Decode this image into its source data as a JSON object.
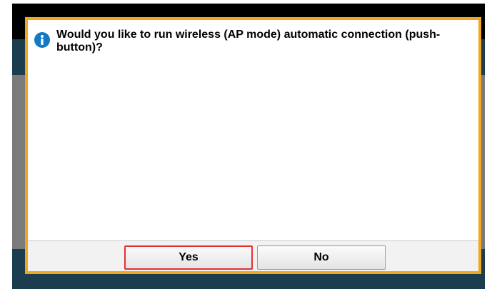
{
  "dialog": {
    "message": "Would you like to run wireless (AP mode) automatic connection (push-button)?",
    "icon": "info-icon",
    "accent_color": "#f0a81e",
    "icon_color": "#1279c6"
  },
  "buttons": {
    "yes_label": "Yes",
    "no_label": "No",
    "selected": "Yes",
    "selected_color": "#e53030"
  }
}
